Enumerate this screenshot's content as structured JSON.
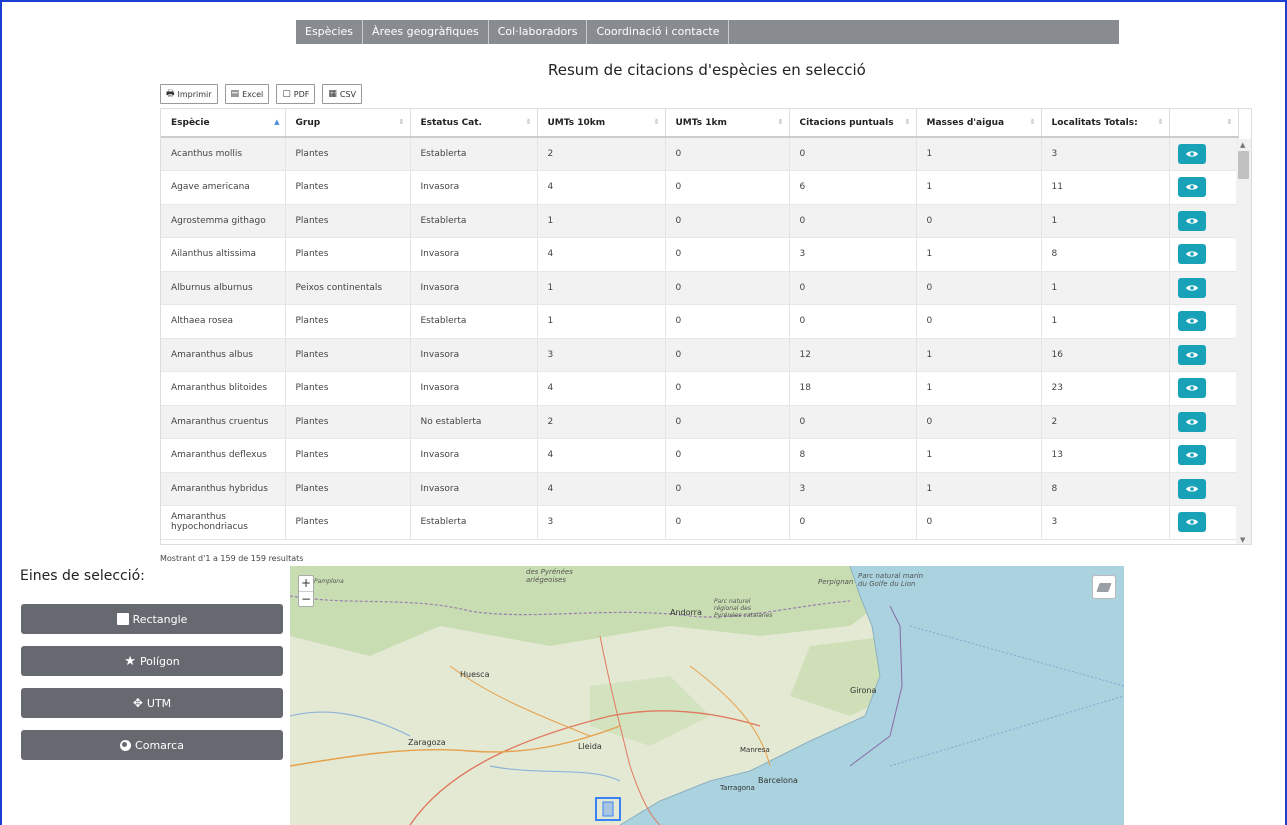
{
  "nav": {
    "items": [
      "Espècies",
      "Àrees geogràfiques",
      "Col·laboradors",
      "Coordinació i contacte"
    ]
  },
  "title": "Resum de citacions d'espècies en selecció",
  "export": {
    "print": "Imprimir",
    "excel": "Excel",
    "pdf": "PDF",
    "csv": "CSV"
  },
  "table": {
    "columns": [
      "Espècie",
      "Grup",
      "Estatus Cat.",
      "UMTs 10km",
      "UMTs 1km",
      "Citacions puntuals",
      "Masses d'aigua",
      "Localitats Totals:",
      ""
    ],
    "rows": [
      [
        "Acanthus mollis",
        "Plantes",
        "Establerta",
        "2",
        "0",
        "0",
        "1",
        "3"
      ],
      [
        "Agave americana",
        "Plantes",
        "Invasora",
        "4",
        "0",
        "6",
        "1",
        "11"
      ],
      [
        "Agrostemma githago",
        "Plantes",
        "Establerta",
        "1",
        "0",
        "0",
        "0",
        "1"
      ],
      [
        "Ailanthus altissima",
        "Plantes",
        "Invasora",
        "4",
        "0",
        "3",
        "1",
        "8"
      ],
      [
        "Alburnus alburnus",
        "Peixos continentals",
        "Invasora",
        "1",
        "0",
        "0",
        "0",
        "1"
      ],
      [
        "Althaea rosea",
        "Plantes",
        "Establerta",
        "1",
        "0",
        "0",
        "0",
        "1"
      ],
      [
        "Amaranthus albus",
        "Plantes",
        "Invasora",
        "3",
        "0",
        "12",
        "1",
        "16"
      ],
      [
        "Amaranthus blitoides",
        "Plantes",
        "Invasora",
        "4",
        "0",
        "18",
        "1",
        "23"
      ],
      [
        "Amaranthus cruentus",
        "Plantes",
        "No establerta",
        "2",
        "0",
        "0",
        "0",
        "2"
      ],
      [
        "Amaranthus deflexus",
        "Plantes",
        "Invasora",
        "4",
        "0",
        "8",
        "1",
        "13"
      ],
      [
        "Amaranthus hybridus",
        "Plantes",
        "Invasora",
        "4",
        "0",
        "3",
        "1",
        "8"
      ],
      [
        "Amaranthus hypochondriacus",
        "Plantes",
        "Establerta",
        "3",
        "0",
        "0",
        "0",
        "3"
      ]
    ]
  },
  "info": "Mostrant d'1 a 159 de 159 resultats",
  "tools": {
    "title": "Eines de selecció:",
    "buttons": [
      "Rectangle",
      "Polígon",
      "UTM",
      "Comarca"
    ]
  },
  "map": {
    "labels": [
      "Huesca",
      "Zaragoza",
      "Lleida",
      "Barcelona",
      "Andorra",
      "Girona",
      "Tarragona",
      "Manresa",
      "Parc natural marin du Golfe du Lion",
      "des Pyrénées ariégeoises",
      "Parc naturel régional des Pyrénées catalanes",
      "Perpignan",
      "Pamplona"
    ],
    "colors": {
      "sea": "#aad3df",
      "land": "#dfe8cf",
      "forest": "#c6ddb0"
    }
  }
}
